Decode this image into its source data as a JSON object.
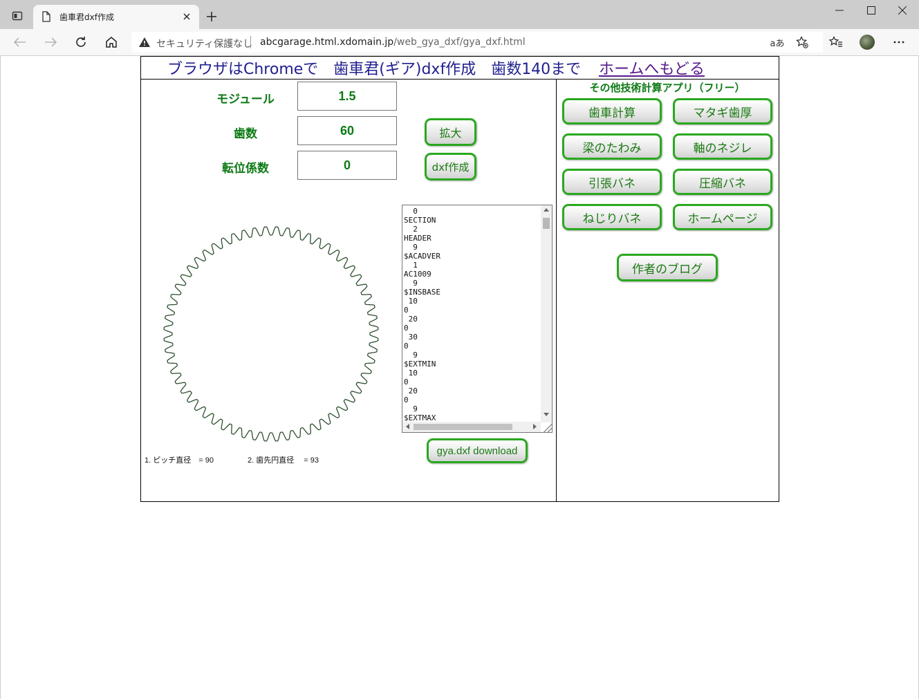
{
  "browser": {
    "tab_title": "歯車君dxf作成",
    "security_label": "セキュリティ保護なし",
    "url_domain": "abcgarage.html.xdomain.jp",
    "url_path": "/web_gya_dxf/gya_dxf.html",
    "reader_label": "aあ"
  },
  "header": {
    "title": "ブラウザはChromeで　歯車君(ギア)dxf作成　歯数140まで",
    "home_link": "ホームへもどる"
  },
  "form": {
    "module_label": "モジュール",
    "module_value": "1.5",
    "teeth_label": "歯数",
    "teeth_value": "60",
    "shift_label": "転位係数",
    "shift_value": "0",
    "zoom_button": "拡大",
    "dxf_button": "dxf作成",
    "download_button": "gya.dxf download"
  },
  "dxf_output": "  0\nSECTION\n  2\nHEADER\n  9\n$ACADVER\n  1\nAC1009\n  9\n$INSBASE\n 10\n0\n 20\n0\n 30\n0\n  9\n$EXTMIN\n 10\n0\n 20\n0\n  9\n$EXTMAX",
  "results": {
    "pitch": "1. ピッチ直径　= 90",
    "tip": "2. 歯先円直径　 = 93"
  },
  "gear": {
    "teeth": 60,
    "color": "#2f4f2f"
  },
  "sidebar": {
    "title": "その他技術計算アプリ（フリー）",
    "items": [
      {
        "label": "歯車計算"
      },
      {
        "label": "マタギ歯厚"
      },
      {
        "label": "梁のたわみ"
      },
      {
        "label": "軸のネジレ"
      },
      {
        "label": "引張バネ"
      },
      {
        "label": "圧縮バネ"
      },
      {
        "label": "ねじりバネ"
      },
      {
        "label": "ホームページ"
      }
    ],
    "blog": "作者のブログ"
  },
  "colors": {
    "accent_green": "#2aa81f",
    "label_green": "#0c7a14",
    "heading_blue": "#1f1f8f",
    "link_purple": "#551a8b"
  }
}
